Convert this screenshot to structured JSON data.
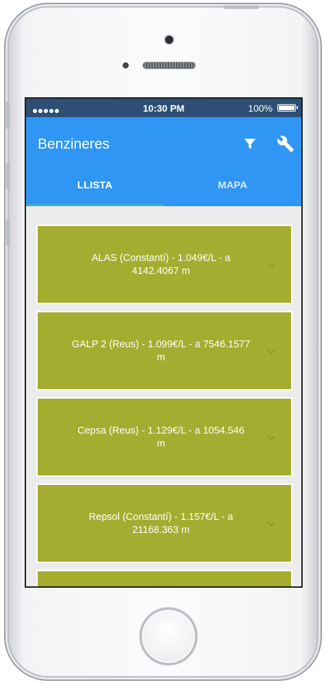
{
  "status_bar": {
    "time": "10:30 PM",
    "battery": "100%",
    "signal_dots": 5
  },
  "app_bar": {
    "title": "Benzineres",
    "filter_icon": "filter-icon",
    "settings_icon": "wrench-icon"
  },
  "tabs": [
    {
      "label": "LLISTA",
      "active": true
    },
    {
      "label": "MAPA",
      "active": false
    }
  ],
  "stations": [
    {
      "line1": "ALAS (Constantí) - 1.049€/L -  a",
      "line2": "4142.4067 m"
    },
    {
      "line1": "GALP 2 (Reus) - 1.099€/L -  a 7546.1577",
      "line2": "m"
    },
    {
      "line1": "Cepsa (Reus) - 1.129€/L -  a 1054.546",
      "line2": "m"
    },
    {
      "line1": "Repsol (Constantí) - 1.157€/L -  a",
      "line2": "21168.363 m"
    }
  ],
  "colors": {
    "app_bar": "#2f96f3",
    "status_bar": "#2d4f75",
    "card": "#a4ad2f",
    "tab_indicator": "#42b1b6",
    "list_background": "#ececec"
  }
}
